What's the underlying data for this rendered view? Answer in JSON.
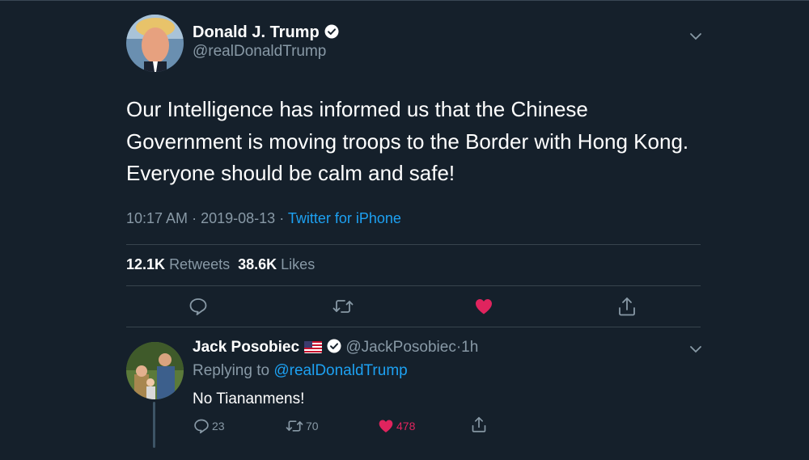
{
  "colors": {
    "background": "#15202b",
    "accent": "#1da1f2",
    "like": "#e0245e",
    "muted": "#8899a6",
    "verified": "#ffffff"
  },
  "tweet": {
    "author_name": "Donald J. Trump",
    "author_handle": "@realDonaldTrump",
    "text": "Our Intelligence has informed us that the Chinese Government is moving troops to the Border with Hong Kong. Everyone should be calm and safe!",
    "time": "10:17 AM",
    "date": "2019-08-13",
    "separator": "·",
    "source": "Twitter for iPhone",
    "retweets_count": "12.1K",
    "retweets_label": "Retweets",
    "likes_count": "38.6K",
    "likes_label": "Likes",
    "icons": [
      "reply-icon",
      "retweet-icon",
      "liked-heart-icon",
      "share-icon"
    ]
  },
  "reply": {
    "author_name": "Jack Posobiec",
    "flag_icon": "us-flag-icon",
    "author_handle": "@JackPosobiec",
    "separator": "·",
    "time": "1h",
    "replying_prefix": "Replying to",
    "replying_to": "@realDonaldTrump",
    "text": "No Tiananmens!",
    "reply_count": "23",
    "retweet_count": "70",
    "like_count": "478"
  }
}
